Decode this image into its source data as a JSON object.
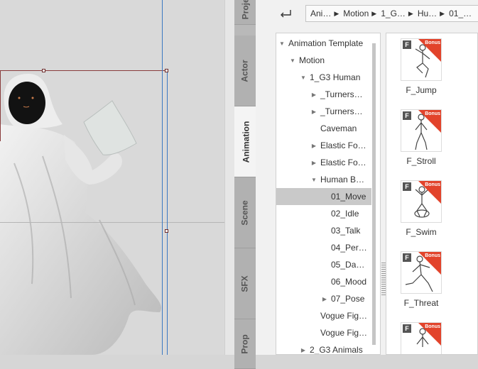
{
  "tabs": [
    {
      "label": "Project"
    },
    {
      "label": "Actor"
    },
    {
      "label": "Animation",
      "active": true
    },
    {
      "label": "Scene"
    },
    {
      "label": "SFX"
    },
    {
      "label": "Prop"
    }
  ],
  "breadcrumb": [
    "Ani…",
    "Motion",
    "1_G…",
    "Hu…",
    "01_…"
  ],
  "tree": [
    {
      "label": "Animation Template",
      "expanded": true
    },
    {
      "label": "Motion",
      "expanded": true
    },
    {
      "label": "1_G3 Human",
      "expanded": true
    },
    {
      "label": "_Turners…",
      "expanded": false
    },
    {
      "label": "_Turners…",
      "expanded": false
    },
    {
      "label": "Caveman"
    },
    {
      "label": "Elastic Fo…",
      "expanded": false
    },
    {
      "label": "Elastic Fo…",
      "expanded": false
    },
    {
      "label": "Human B…",
      "expanded": true
    },
    {
      "label": "01_Move",
      "selected": true
    },
    {
      "label": "02_Idle"
    },
    {
      "label": "03_Talk"
    },
    {
      "label": "04_Per…"
    },
    {
      "label": "05_Da…"
    },
    {
      "label": "06_Mood"
    },
    {
      "label": "07_Pose",
      "expanded": false
    },
    {
      "label": "Vogue Fig…"
    },
    {
      "label": "Vogue Fig…"
    },
    {
      "label": "2_G3 Animals",
      "expanded": false
    }
  ],
  "motions": [
    {
      "label": "F_Jump",
      "badge": "F",
      "bonus": "Bonus"
    },
    {
      "label": "F_Stroll",
      "badge": "F",
      "bonus": "Bonus"
    },
    {
      "label": "F_Swim",
      "badge": "F",
      "bonus": "Bonus"
    },
    {
      "label": "F_Threat",
      "badge": "F",
      "bonus": "Bonus"
    },
    {
      "label": "",
      "badge": "F",
      "bonus": "Bonus"
    }
  ],
  "colors": {
    "accent": "#e2432b",
    "selection": "#c9c9c9",
    "guide_blue": "#3b78c2",
    "guide_red": "#8a3c3c"
  },
  "icons": {
    "back": "return-arrow-icon",
    "badge": "f-badge-icon",
    "figure": "wooden-mannequin-icon"
  }
}
